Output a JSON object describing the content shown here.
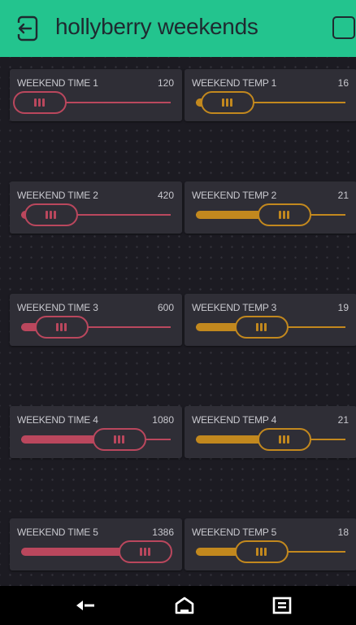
{
  "app": {
    "title": "hollyberry weekends"
  },
  "colors": {
    "header_bg": "#23c48e",
    "time_slider": "#e9506b",
    "temp_slider": "#f4a616",
    "widget_bg": "#2f2e36",
    "dashboard_bg": "#1c1b22"
  },
  "widgets": [
    {
      "label": "WEEKEND TIME 1",
      "value": "120",
      "level": 0.0,
      "color": "#e9506b"
    },
    {
      "label": "WEEKEND TEMP 1",
      "value": "16",
      "level": 0.21,
      "color": "#f4a616"
    },
    {
      "label": "WEEKEND TIME 2",
      "value": "420",
      "level": 0.2,
      "color": "#e9506b"
    },
    {
      "label": "WEEKEND TEMP 2",
      "value": "21",
      "level": 0.59,
      "color": "#f4a616"
    },
    {
      "label": "WEEKEND TIME 3",
      "value": "600",
      "level": 0.27,
      "color": "#e9506b"
    },
    {
      "label": "WEEKEND TEMP 3",
      "value": "19",
      "level": 0.44,
      "color": "#f4a616"
    },
    {
      "label": "WEEKEND TIME 4",
      "value": "1080",
      "level": 0.66,
      "color": "#e9506b"
    },
    {
      "label": "WEEKEND TEMP 4",
      "value": "21",
      "level": 0.59,
      "color": "#f4a616"
    },
    {
      "label": "WEEKEND TIME 5",
      "value": "1386",
      "level": 0.83,
      "color": "#e9506b"
    },
    {
      "label": "WEEKEND TEMP 5",
      "value": "18",
      "level": 0.44,
      "color": "#f4a616"
    }
  ],
  "navbar": {
    "icons": [
      "back-icon",
      "home-icon",
      "recent-apps-icon"
    ]
  }
}
